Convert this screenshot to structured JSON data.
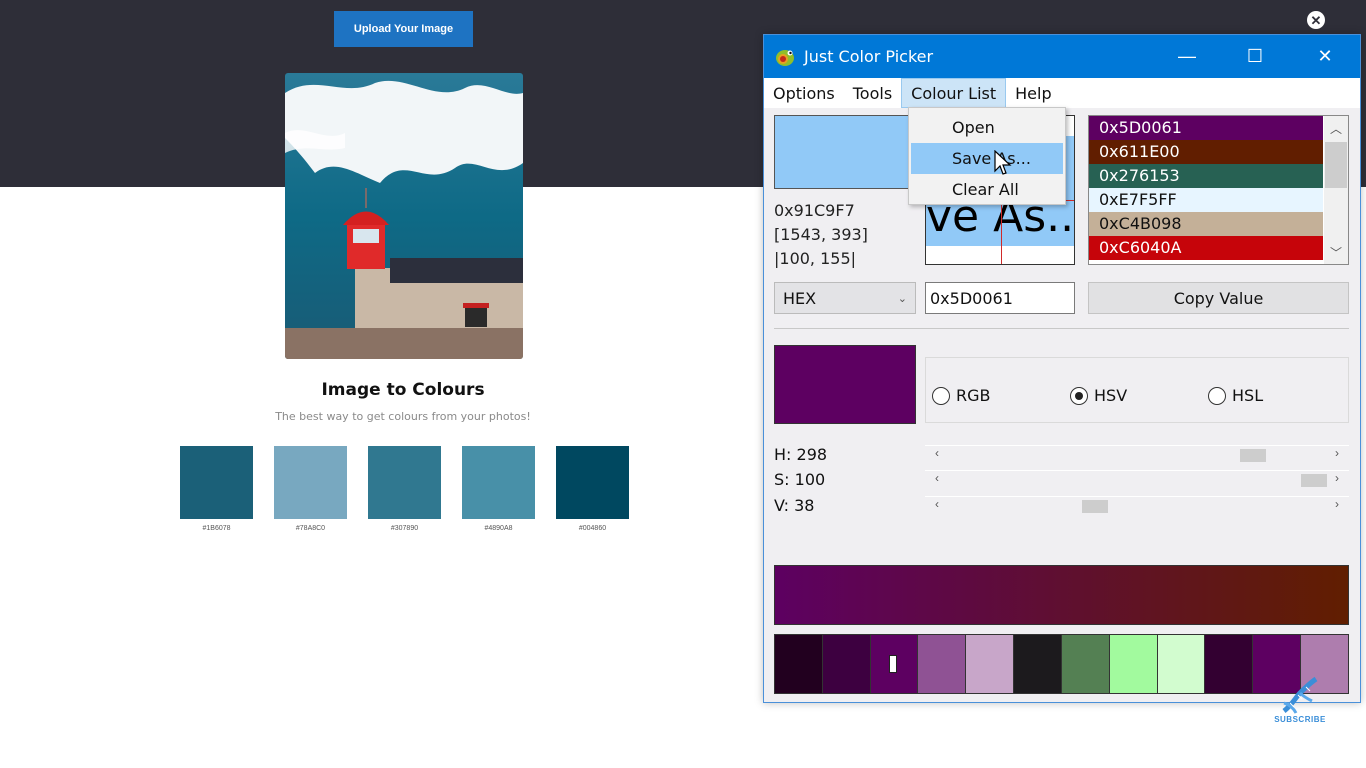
{
  "page": {
    "upload_button": "Upload Your Image",
    "close_symbol": "✕",
    "title": "Image to Colours",
    "subtitle": "The best way to get colours from your photos!",
    "photo_alt": "Giant wave behind a red lighthouse with crowd of people",
    "swatches": [
      {
        "color": "#1B6078",
        "label": "#1B6078"
      },
      {
        "color": "#78A8C0",
        "label": "#78A8C0"
      },
      {
        "color": "#307890",
        "label": "#307890"
      },
      {
        "color": "#4890A8",
        "label": "#4890A8"
      },
      {
        "color": "#004860",
        "label": "#004860"
      }
    ]
  },
  "app": {
    "title": "Just Color Picker",
    "window_controls": {
      "minimize": "—",
      "maximize": "☐",
      "close": "✕"
    },
    "menu": [
      "Options",
      "Tools",
      "Colour List",
      "Help"
    ],
    "active_menu": "Colour List",
    "dropdown": [
      "Open",
      "Save As...",
      "Clear All"
    ],
    "highlighted_dropdown_item": "Save As...",
    "current_color": {
      "hex": "0x91C9F7",
      "swatch": "#91C9F7",
      "screen_coords": "[1543, 393]",
      "window_coords": "|100, 155|"
    },
    "magnifier_text": "ve As..",
    "colour_list": [
      {
        "label": "0x5D0061",
        "bg": "#5D0061",
        "fg": "#ffffff"
      },
      {
        "label": "0x611E00",
        "bg": "#611E00",
        "fg": "#ffffff"
      },
      {
        "label": "0x276153",
        "bg": "#276153",
        "fg": "#ffffff"
      },
      {
        "label": "0xE7F5FF",
        "bg": "#E7F5FF",
        "fg": "#111111"
      },
      {
        "label": "0xC4B098",
        "bg": "#C4B098",
        "fg": "#111111"
      },
      {
        "label": "0xC6040A",
        "bg": "#C6040A",
        "fg": "#ffffff"
      }
    ],
    "format_select": "HEX",
    "value_field": "0x5D0061",
    "copy_button": "Copy Value",
    "selected_color": "#5D0061",
    "modes": [
      {
        "label": "RGB",
        "checked": false
      },
      {
        "label": "HSV",
        "checked": true
      },
      {
        "label": "HSL",
        "checked": false
      }
    ],
    "sliders": [
      {
        "label": "H: 298",
        "value": 298,
        "max": 360
      },
      {
        "label": "S: 100",
        "value": 100,
        "max": 100
      },
      {
        "label": "V: 38",
        "value": 38,
        "max": 100
      }
    ],
    "gradient": {
      "from": "#5D0061",
      "to": "#611E00"
    },
    "palette": [
      "#22001F",
      "#3D0040",
      "#5D0061",
      "#8F5294",
      "#C8A6C9",
      "#1C1A1D",
      "#548053",
      "#A2FA9E",
      "#D2FCCF",
      "#330031",
      "#5D0061",
      "#AE7DAE"
    ],
    "palette_selected_index": 2
  },
  "overlay": {
    "subscribe_label": "SUBSCRIBE"
  }
}
